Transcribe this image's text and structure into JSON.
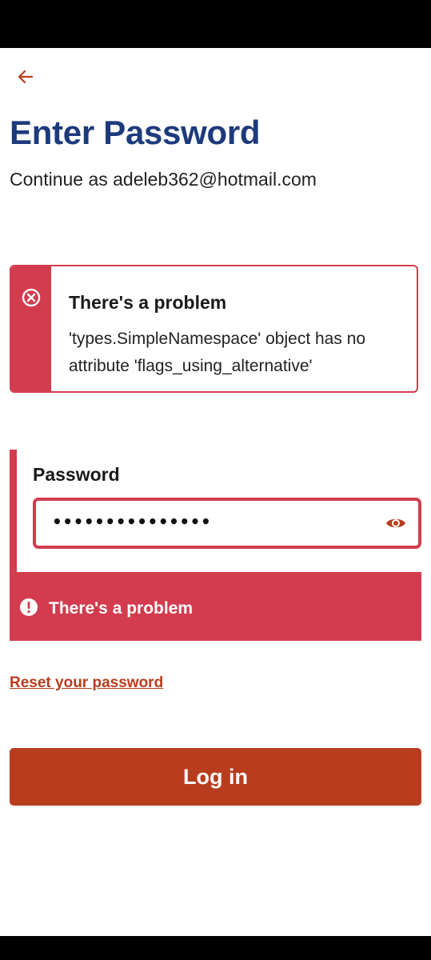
{
  "header": {
    "back_icon": "arrow-left-icon",
    "title": "Enter Password",
    "subtitle": "Continue as adeleb362@hotmail.com"
  },
  "error_summary": {
    "icon": "x-circle-icon",
    "heading": "There's a problem",
    "message": "'types.SimpleNamespace' object has no attribute 'flags_using_alternative'"
  },
  "password_field": {
    "label": "Password",
    "masked_value": "•••••••••••••••",
    "toggle_icon": "eye-icon",
    "error_icon": "exclamation-circle-icon",
    "error_text": "There's a problem"
  },
  "links": {
    "reset_password": "Reset your password"
  },
  "actions": {
    "login_label": "Log in"
  },
  "colors": {
    "title": "#1d3a7c",
    "error": "#d33c4e",
    "accent": "#b83d1e",
    "status_bar": "#000000"
  }
}
